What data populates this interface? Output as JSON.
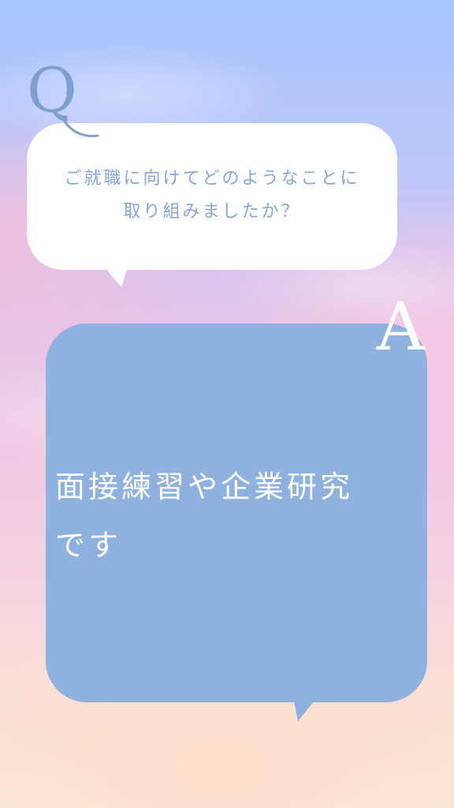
{
  "question": {
    "marker": "Q",
    "lines": [
      "ご就職に向けてどのようなことに",
      "取り組みましたか？"
    ]
  },
  "answer": {
    "marker": "A",
    "lines": [
      "面接練習や企業研究",
      "です"
    ]
  },
  "colors": {
    "question_bubble": "#ffffff",
    "question_text": "#86a6d6",
    "question_marker": "#7f9fcf",
    "answer_bubble": "#8fb1e0",
    "answer_text": "#ffffff",
    "answer_marker": "#ffffff"
  }
}
